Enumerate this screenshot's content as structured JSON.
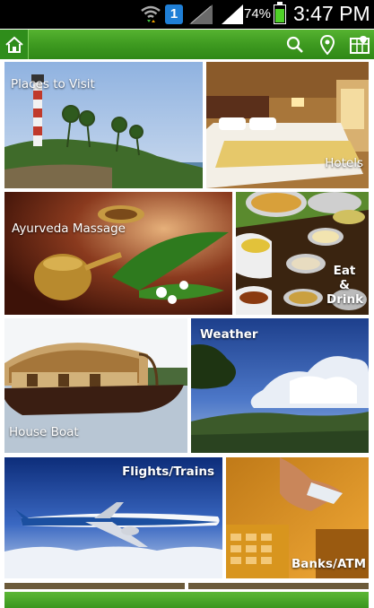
{
  "status_bar": {
    "sim_badge": "1",
    "battery_percent": "74%",
    "battery_level": 0.74,
    "time": "3:47 PM",
    "icons": [
      "wifi-icon",
      "sim-badge",
      "no-signal-icon",
      "signal-icon",
      "battery-icon"
    ]
  },
  "action_bar": {
    "color": "#3e9a20",
    "icons": [
      "home-icon",
      "search-icon",
      "location-pin-icon",
      "map-icon"
    ]
  },
  "tiles": [
    {
      "id": "places",
      "label": "Places to Visit"
    },
    {
      "id": "hotels",
      "label": "Hotels"
    },
    {
      "id": "ayurveda",
      "label": "Ayurveda Massage"
    },
    {
      "id": "eat",
      "label": "Eat & Drink"
    },
    {
      "id": "boat",
      "label": "House Boat"
    },
    {
      "id": "weather",
      "label": "Weather"
    },
    {
      "id": "flights",
      "label": "Flights/Trains"
    },
    {
      "id": "banks",
      "label": "Banks/ATM"
    }
  ]
}
